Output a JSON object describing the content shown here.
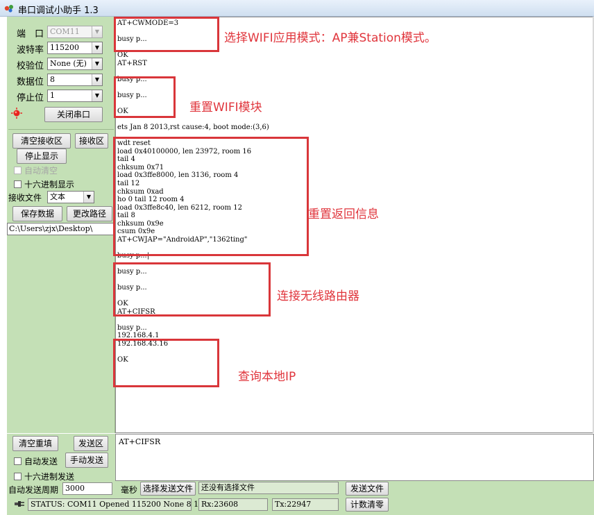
{
  "window": {
    "title": "串口调试小助手 1.3"
  },
  "settings": {
    "port_label": "端　口",
    "port_value": "COM11",
    "baud_label": "波特率",
    "baud_value": "115200",
    "parity_label": "校验位",
    "parity_value": "None (无)",
    "databits_label": "数据位",
    "databits_value": "8",
    "stopbits_label": "停止位",
    "stopbits_value": "1",
    "close_port_label": "关闭串口"
  },
  "receive": {
    "clear_label": "清空接收区",
    "area_label": "接收区",
    "stop_display_label": "停止显示",
    "auto_clear_label": "自动清空",
    "hex_display_label": "十六进制显示",
    "file_label": "接收文件",
    "file_type_value": "文本",
    "save_label": "保存数据",
    "change_path_label": "更改路径",
    "path_value": "C:\\Users\\zjx\\Desktop\\",
    "lines": [
      "AT+CWMODE=3",
      "",
      "busy p...",
      "",
      "OK",
      "AT+RST",
      "",
      "busy p...",
      "",
      "busy p...",
      "",
      "OK",
      "",
      "ets Jan  8 2013,rst cause:4, boot mode:(3,6)",
      "",
      "wdt reset",
      "load 0x40100000, len 23972, room 16",
      "tail 4",
      "chksum 0x71",
      "load 0x3ffe8000, len 3136, room 4",
      "tail 12",
      "chksum 0xad",
      "ho 0 tail 12 room 4",
      "load 0x3ffe8c40, len 6212, room 12",
      "tail 8",
      "chksum 0x9e",
      "csum 0x9e",
      "AT+CWJAP=\"AndroidAP\",\"1362ting\"",
      "",
      "busy p...|",
      "",
      "busy p...",
      "",
      "busy p...",
      "",
      "OK",
      "AT+CIFSR",
      "",
      "busy p...",
      "192.168.4.1",
      "192.168.43.16",
      "",
      "OK"
    ]
  },
  "annotations": [
    {
      "text": "选择WIFI应用模式：AP兼Station模式。"
    },
    {
      "text": "重置WIFI模块"
    },
    {
      "text": "重置返回信息"
    },
    {
      "text": "连接无线路由器"
    },
    {
      "text": "查询本地IP"
    }
  ],
  "send": {
    "clear_label": "清空重填",
    "area_label": "发送区",
    "auto_send_label": "自动发送",
    "manual_send_label": "手动发送",
    "hex_send_label": "十六进制发送",
    "content": "AT+CIFSR"
  },
  "bottom": {
    "period_label": "自动发送周期",
    "period_value": "3000",
    "ms_label": "毫秒",
    "choose_file_label": "选择发送文件",
    "no_file_text": "还没有选择文件",
    "send_file_label": "发送文件",
    "status_text": "STATUS: COM11 Opened 115200 None  8 1",
    "rx_text": "Rx:23608",
    "tx_text": "Tx:22947",
    "reset_count_label": "计数清零"
  },
  "colors": {
    "panel_green": "#c4e0b6",
    "annotation_red": "#d9363a",
    "led_red": "#e8231e"
  }
}
